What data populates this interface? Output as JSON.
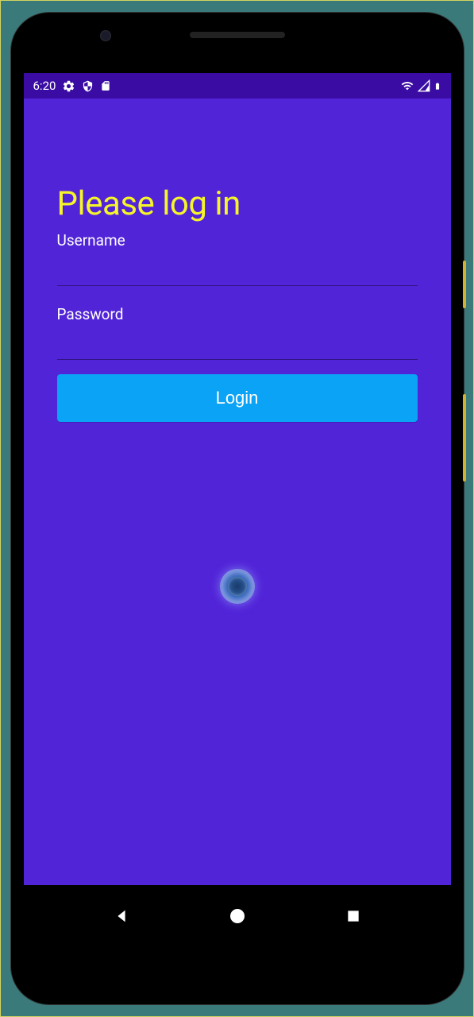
{
  "statusBar": {
    "time": "6:20"
  },
  "login": {
    "title": "Please log in",
    "usernameLabel": "Username",
    "usernameValue": "",
    "passwordLabel": "Password",
    "passwordValue": "",
    "buttonLabel": "Login"
  }
}
